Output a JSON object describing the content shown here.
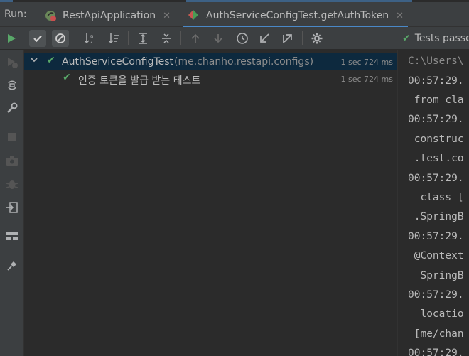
{
  "run_label": "Run:",
  "tabs": [
    {
      "label": "RestApiApplication"
    },
    {
      "label": "AuthServiceConfigTest.getAuthToken"
    }
  ],
  "close_glyph": "✕",
  "status": {
    "text": "Tests passe"
  },
  "tree": {
    "suite": {
      "name": "AuthServiceConfigTest",
      "package": "(me.chanho.restapi.configs)",
      "time": "1 sec 724 ms"
    },
    "test": {
      "name": "인증 토큰을 발급 받는 테스트",
      "time": "1 sec 724 ms"
    }
  },
  "console_lines": [
    "C:\\Users\\",
    "00:57:29.",
    " from cla",
    "00:57:29.",
    " construc",
    " .test.co",
    "00:57:29.",
    "  class [",
    " .SpringB",
    "00:57:29.",
    " @Context",
    "  SpringB",
    "00:57:29.",
    "  locatio",
    " [me/chan",
    "00:57:29."
  ],
  "colors": {
    "accent": "#4a88c7",
    "success": "#59a869",
    "selection": "#0d293e"
  }
}
